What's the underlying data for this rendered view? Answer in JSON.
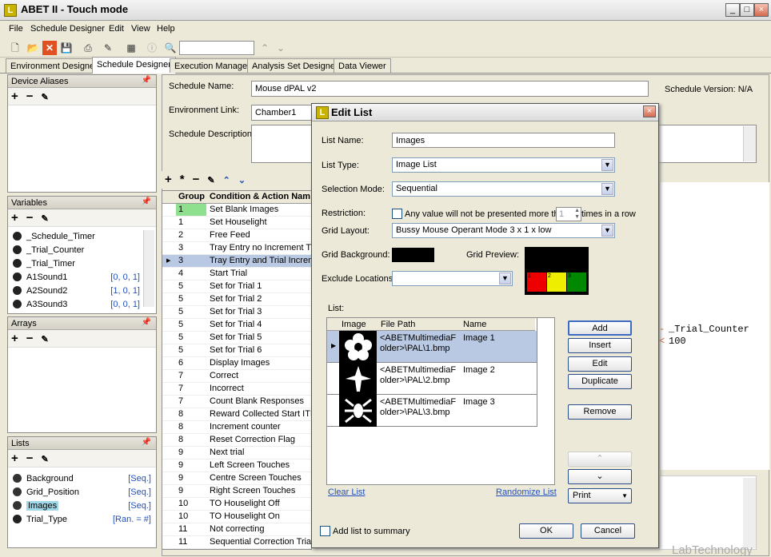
{
  "app": {
    "title": "ABET II - Touch mode",
    "icon_letter": "L"
  },
  "menu": [
    "File",
    "Schedule Designer",
    "Edit",
    "View",
    "Help"
  ],
  "tabs": [
    "Environment Designer",
    "Schedule Designer",
    "Execution Manager",
    "Analysis Set Designer",
    "Data Viewer"
  ],
  "panels": {
    "device_aliases": {
      "title": "Device Aliases"
    },
    "variables": {
      "title": "Variables",
      "items": [
        {
          "name": "_Schedule_Timer",
          "value": ""
        },
        {
          "name": "_Trial_Counter",
          "value": ""
        },
        {
          "name": "_Trial_Timer",
          "value": ""
        },
        {
          "name": "A1Sound1",
          "value": "[0, 0, 1]"
        },
        {
          "name": "A2Sound2",
          "value": "[1, 0, 1]"
        },
        {
          "name": "A3Sound3",
          "value": "[0, 0, 1]"
        }
      ]
    },
    "arrays": {
      "title": "Arrays"
    },
    "lists": {
      "title": "Lists",
      "items": [
        {
          "name": "Background",
          "value": "[Seq.]"
        },
        {
          "name": "Grid_Position",
          "value": "[Seq.]"
        },
        {
          "name": "Images",
          "value": "[Seq.]"
        },
        {
          "name": "Trial_Type",
          "value": "[Ran. = #]"
        }
      ]
    }
  },
  "schedule": {
    "name_label": "Schedule Name:",
    "name": "Mouse dPAL v2",
    "env_label": "Environment Link:",
    "env": "Chamber1",
    "desc_label": "Schedule Description:",
    "version": "Schedule Version: N/A"
  },
  "grid": {
    "headers": [
      "Group",
      "Condition & Action Nam"
    ],
    "rows": [
      [
        "1",
        "Set Blank Images"
      ],
      [
        "1",
        "Set Houselight"
      ],
      [
        "2",
        "Free Feed"
      ],
      [
        "3",
        "Tray Entry no Increment Tri"
      ],
      [
        "3",
        "Tray Entry and Trial Increm"
      ],
      [
        "4",
        "Start Trial"
      ],
      [
        "5",
        "Set for Trial 1"
      ],
      [
        "5",
        "Set for Trial 2"
      ],
      [
        "5",
        "Set for Trial 3"
      ],
      [
        "5",
        "Set for Trial 4"
      ],
      [
        "5",
        "Set for Trial 5"
      ],
      [
        "5",
        "Set for Trial 6"
      ],
      [
        "6",
        "Display Images"
      ],
      [
        "7",
        "Correct"
      ],
      [
        "7",
        "Incorrect"
      ],
      [
        "7",
        "Count Blank Responses"
      ],
      [
        "8",
        "Reward Collected Start ITI"
      ],
      [
        "8",
        "Increment counter"
      ],
      [
        "8",
        "Reset Correction Flag"
      ],
      [
        "9",
        "Next trial"
      ],
      [
        "9",
        "Left Screen Touches"
      ],
      [
        "9",
        "Centre Screen Touches"
      ],
      [
        "9",
        "Right Screen Touches"
      ],
      [
        "10",
        "TO Houselight Off"
      ],
      [
        "10",
        "TO Houselight On"
      ],
      [
        "11",
        "Not correcting"
      ],
      [
        "11",
        "Sequential Correction Trial"
      ]
    ]
  },
  "code_lines": [
    "_Trial_Counter",
    "100"
  ],
  "watermark": "LabTechnology",
  "dialog": {
    "title": "Edit List",
    "list_name_label": "List Name:",
    "list_name": "Images",
    "list_type_label": "List Type:",
    "list_type": "Image List",
    "selection_mode_label": "Selection Mode:",
    "selection_mode": "Sequential",
    "restriction_label": "Restriction:",
    "restriction_text": "Any value will not be presented more than",
    "restriction_value": "1",
    "restriction_suffix": "times in a row",
    "grid_layout_label": "Grid Layout:",
    "grid_layout": "Bussy Mouse Operant Mode 3 x 1 x low",
    "grid_background_label": "Grid Background:",
    "grid_preview_label": "Grid Preview:",
    "grid_cells": [
      "1",
      "2",
      "3"
    ],
    "exclude_label": "Exclude Locations:",
    "list_label": "List:",
    "table_headers": [
      "Image",
      "File Path",
      "Name"
    ],
    "items": [
      {
        "path": "<ABETMultimediaFolder>\\PAL\\1.bmp",
        "path1": "<ABETMultimediaF",
        "path2": "older>\\PAL\\1.bmp",
        "name": "Image 1"
      },
      {
        "path": "<ABETMultimediaFolder>\\PAL\\2.bmp",
        "path1": "<ABETMultimediaF",
        "path2": "older>\\PAL\\2.bmp",
        "name": "Image 2"
      },
      {
        "path": "<ABETMultimediaFolder>\\PAL\\3.bmp",
        "path1": "<ABETMultimediaF",
        "path2": "older>\\PAL\\3.bmp",
        "name": "Image 3"
      }
    ],
    "buttons": {
      "add": "Add",
      "insert": "Insert",
      "edit": "Edit",
      "duplicate": "Duplicate",
      "remove": "Remove",
      "print": "Print",
      "ok": "OK",
      "cancel": "Cancel"
    },
    "clear_list": "Clear List",
    "randomize_list": "Randomize List",
    "add_summary": "Add list to summary"
  }
}
